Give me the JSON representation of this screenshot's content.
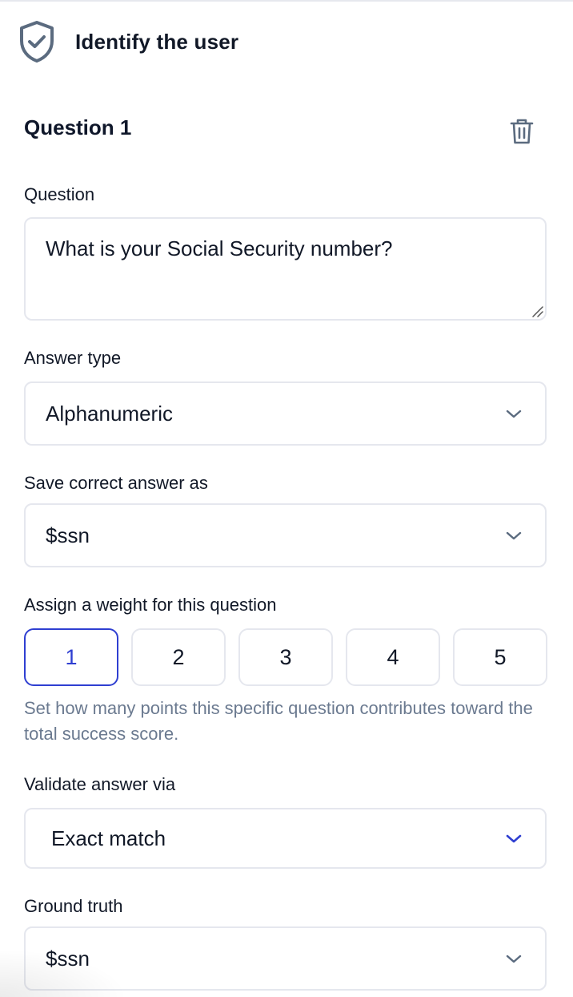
{
  "header": {
    "title": "Identify the user",
    "icon": "shield-check-icon"
  },
  "question": {
    "heading": "Question 1",
    "delete_icon": "trash-icon",
    "question_label": "Question",
    "question_value": "What is your Social Security number?",
    "answer_type_label": "Answer type",
    "answer_type_value": "Alphanumeric",
    "save_as_label": "Save correct answer as",
    "save_as_value": "$ssn",
    "weight_label": "Assign a weight for this question",
    "weights": [
      "1",
      "2",
      "3",
      "4",
      "5"
    ],
    "selected_weight": "1",
    "weight_hint": "Set how many points this specific question contributes toward the total success score.",
    "validate_label": "Validate answer via",
    "validate_value": "Exact match",
    "ground_truth_label": "Ground truth",
    "ground_truth_value": "$ssn"
  },
  "colors": {
    "accent": "#2f3fd1",
    "border": "#e5e7ee",
    "hint_text": "#6b7a90",
    "icon_gray": "#5b6b7f"
  }
}
